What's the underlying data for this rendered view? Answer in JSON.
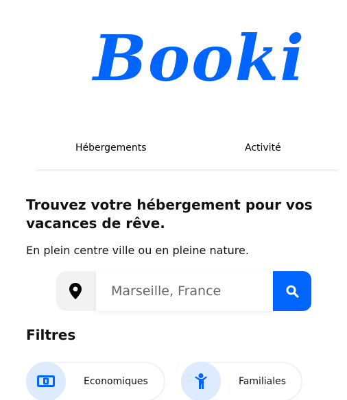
{
  "brand": {
    "logo_text": "Booki"
  },
  "nav": {
    "items": [
      "Hébergements",
      "Activité"
    ]
  },
  "hero": {
    "headline": "Trouvez votre hébergement pour vos vacances de rêve.",
    "subline": "En plein centre ville ou en pleine nature."
  },
  "search": {
    "placeholder": "Marseille, France",
    "location_icon": "map-pin-icon",
    "button_icon": "search-icon"
  },
  "filters": {
    "title": "Filtres",
    "items": [
      {
        "label": "Economiques",
        "icon": "money-bill-icon"
      },
      {
        "label": "Familiales",
        "icon": "child-icon"
      }
    ]
  },
  "colors": {
    "accent": "#0065fc",
    "light_accent": "#deebff",
    "neutral_bg": "#f2f2f2"
  }
}
